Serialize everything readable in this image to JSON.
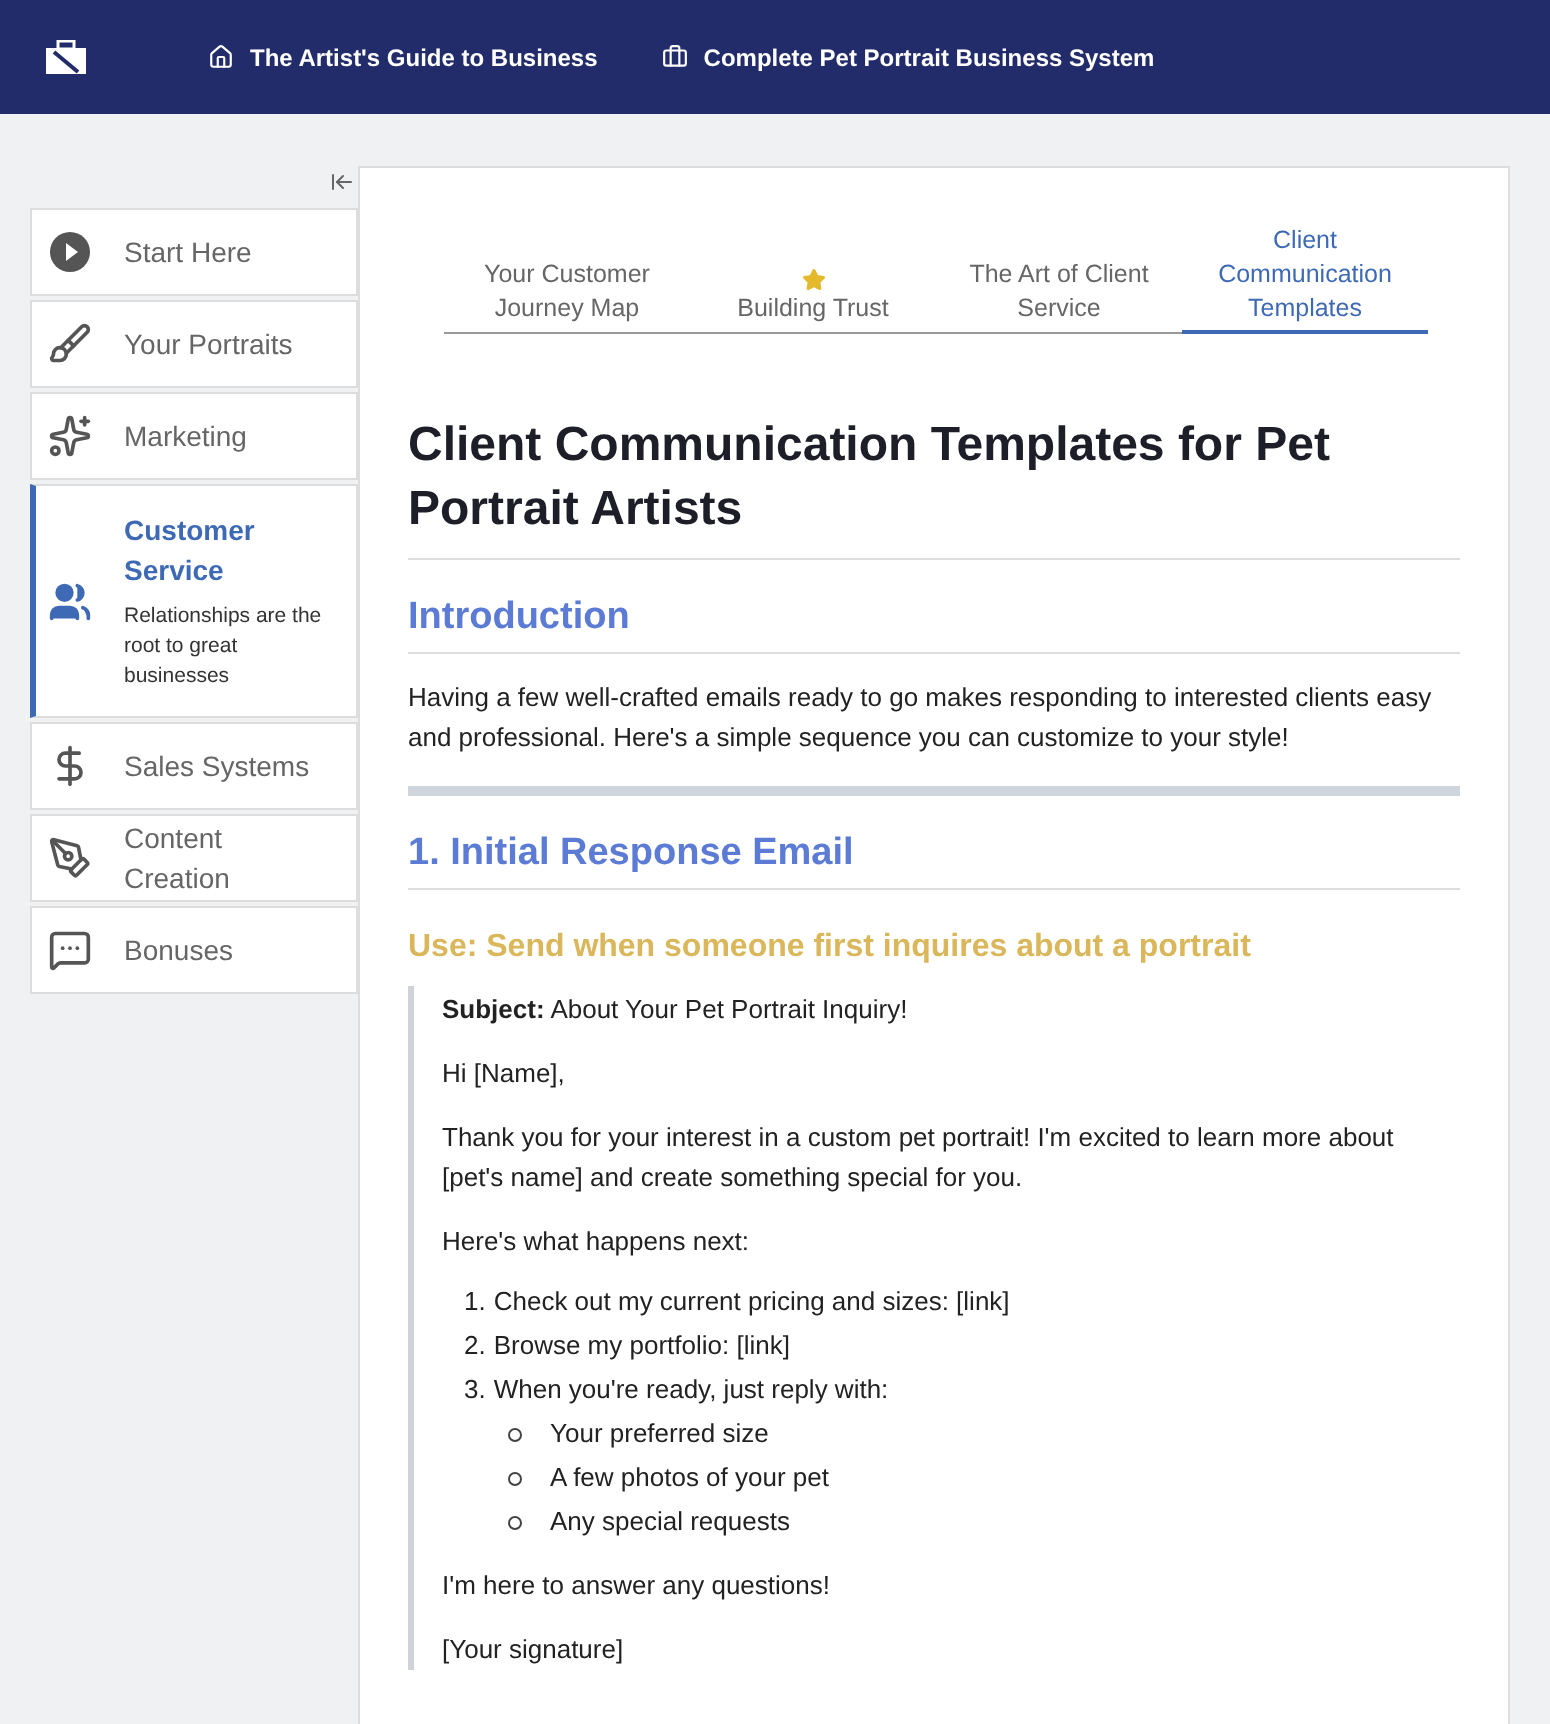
{
  "header": {
    "breadcrumbs": [
      {
        "label": "The Artist's Guide to Business"
      },
      {
        "label": "Complete Pet Portrait Business System"
      }
    ]
  },
  "sidebar": {
    "items": [
      {
        "label": "Start Here",
        "selected": false
      },
      {
        "label": "Your Portraits",
        "selected": false
      },
      {
        "label": "Marketing",
        "selected": false
      },
      {
        "label": "Customer Service",
        "selected": true,
        "description": "Relationships are the root to great businesses"
      },
      {
        "label": "Sales Systems",
        "selected": false
      },
      {
        "label": "Content Creation",
        "selected": false
      },
      {
        "label": "Bonuses",
        "selected": false
      }
    ]
  },
  "tabs": [
    {
      "label": "Your Customer Journey Map",
      "selected": false,
      "starred": false
    },
    {
      "label": "Building Trust",
      "selected": false,
      "starred": true
    },
    {
      "label": "The Art of Client Service",
      "selected": false,
      "starred": false
    },
    {
      "label": "Client Communication Templates",
      "selected": true,
      "starred": false
    }
  ],
  "article": {
    "title": "Client Communication Templates for Pet Portrait Artists",
    "intro_heading": "Introduction",
    "intro": "Having a few well-crafted emails ready to go makes responding to interested clients easy and professional. Here's a simple sequence you can customize to your style!",
    "section_heading": "1. Initial Response Email",
    "use_heading": "Use: Send when someone first inquires about a portrait",
    "email": {
      "subject": "**Subject:** About Your Pet Portrait Inquiry!",
      "greeting": "Hi [Name],",
      "body": "Thank you for your interest in a custom pet portrait! I'm excited to learn more about [pet's name] and create something special for you.",
      "next": "Here's what happens next:",
      "steps": [
        {
          "number": "1.",
          "text": "Check out my current pricing and sizes: [link]"
        },
        {
          "number": "2.",
          "text": "Browse my portfolio: [link]"
        },
        {
          "number": "3.",
          "text": "When you're ready, just reply with:",
          "bullets": [
            "Your preferred size",
            "A few photos of your pet",
            "Any special requests"
          ]
        }
      ],
      "closing": "I'm here to answer any questions!",
      "signature": "[Your signature]"
    }
  }
}
